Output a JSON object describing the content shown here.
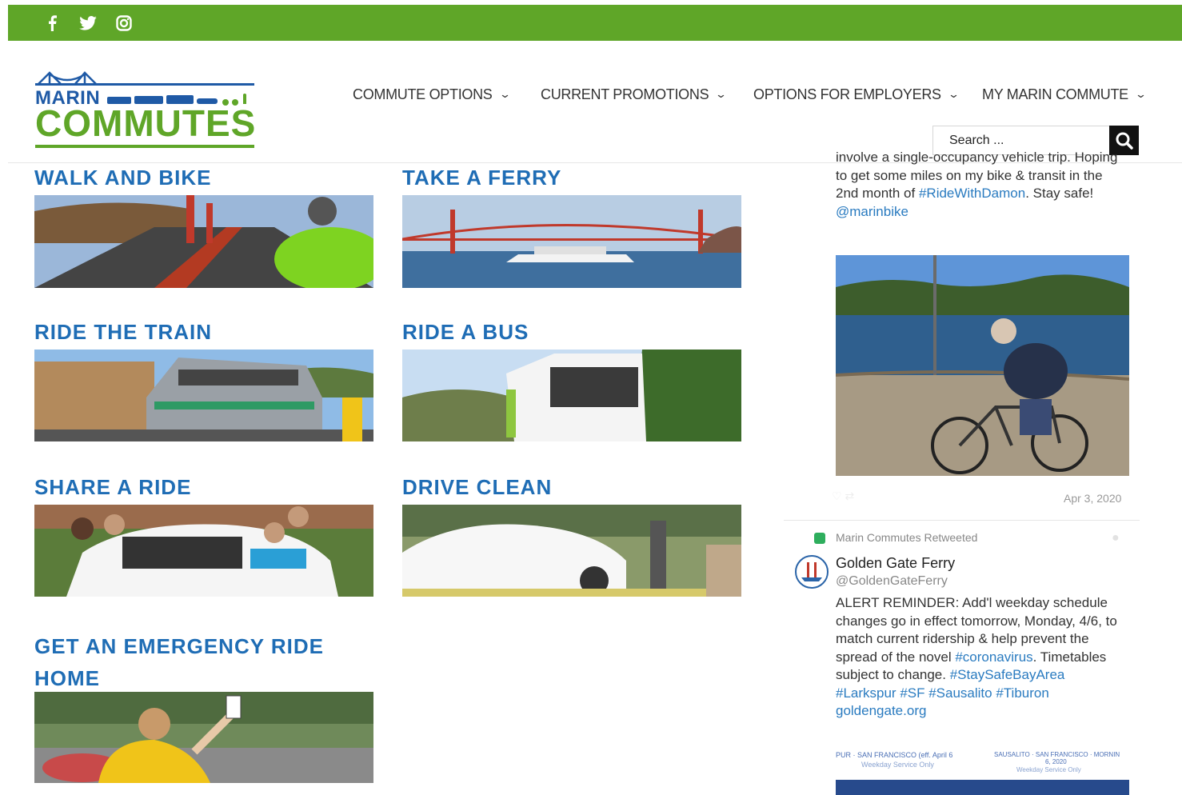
{
  "social": {
    "facebook_glyph": "f",
    "twitter_glyph": "🐦",
    "instagram_glyph": "◎"
  },
  "logo": {
    "line1": "MARIN",
    "line2": "COMMUTES"
  },
  "nav": [
    {
      "label": "COMMUTE OPTIONS"
    },
    {
      "label": "CURRENT PROMOTIONS"
    },
    {
      "label": "OPTIONS FOR EMPLOYERS"
    },
    {
      "label": "MY MARIN COMMUTE"
    }
  ],
  "search": {
    "placeholder": "Search ..."
  },
  "cards": [
    {
      "title": "WALK AND BIKE"
    },
    {
      "title": "TAKE A FERRY"
    },
    {
      "title": "RIDE THE TRAIN"
    },
    {
      "title": "RIDE A BUS"
    },
    {
      "title": "SHARE A RIDE"
    },
    {
      "title": "DRIVE CLEAN"
    },
    {
      "title_line1": "GET AN EMERGENCY RIDE",
      "title_line2": "HOME"
    }
  ],
  "tweet1": {
    "cut_line": "involve a single-occupancy vehicle trip. Hoping",
    "line2": "to get some miles on my bike & transit in the",
    "line3_pre": "2nd month of ",
    "line3_tag": "#RideWithDamon",
    "line3_post": ". Stay safe!",
    "mention": "@marinbike",
    "date": "Apr 3, 2020"
  },
  "tweet2": {
    "retweeted_label": "Marin Commutes Retweeted",
    "author": "Golden Gate Ferry",
    "handle": "@GoldenGateFerry",
    "l1": "ALERT REMINDER: Add'l weekday schedule",
    "l2": "changes go in effect tomorrow, Monday, 4/6, to",
    "l3": "match current ridership & help prevent the",
    "l4_pre": "spread of the novel ",
    "l4_tag": "#coronavirus",
    "l4_post": ". Timetables",
    "l5_pre": "subject to change. ",
    "l5_tag": "#StaySafeBayArea",
    "l6_tags": "#Larkspur #SF #Sausalito #Tiburon",
    "l7_link": "goldengate.org",
    "schedule_left": "PUR · SAN FRANCISCO (eff. April 6",
    "schedule_left_sub": "Weekday Service Only",
    "schedule_right": "SAUSALITO · SAN FRANCISCO · MORNIN",
    "schedule_right_date": "6, 2020",
    "schedule_right_sub": "Weekday Service Only"
  },
  "colors": {
    "brand_green": "#5fa628",
    "brand_blue": "#1f5aa6",
    "title_blue": "#1f6db5",
    "link_blue": "#2a7bc0"
  }
}
